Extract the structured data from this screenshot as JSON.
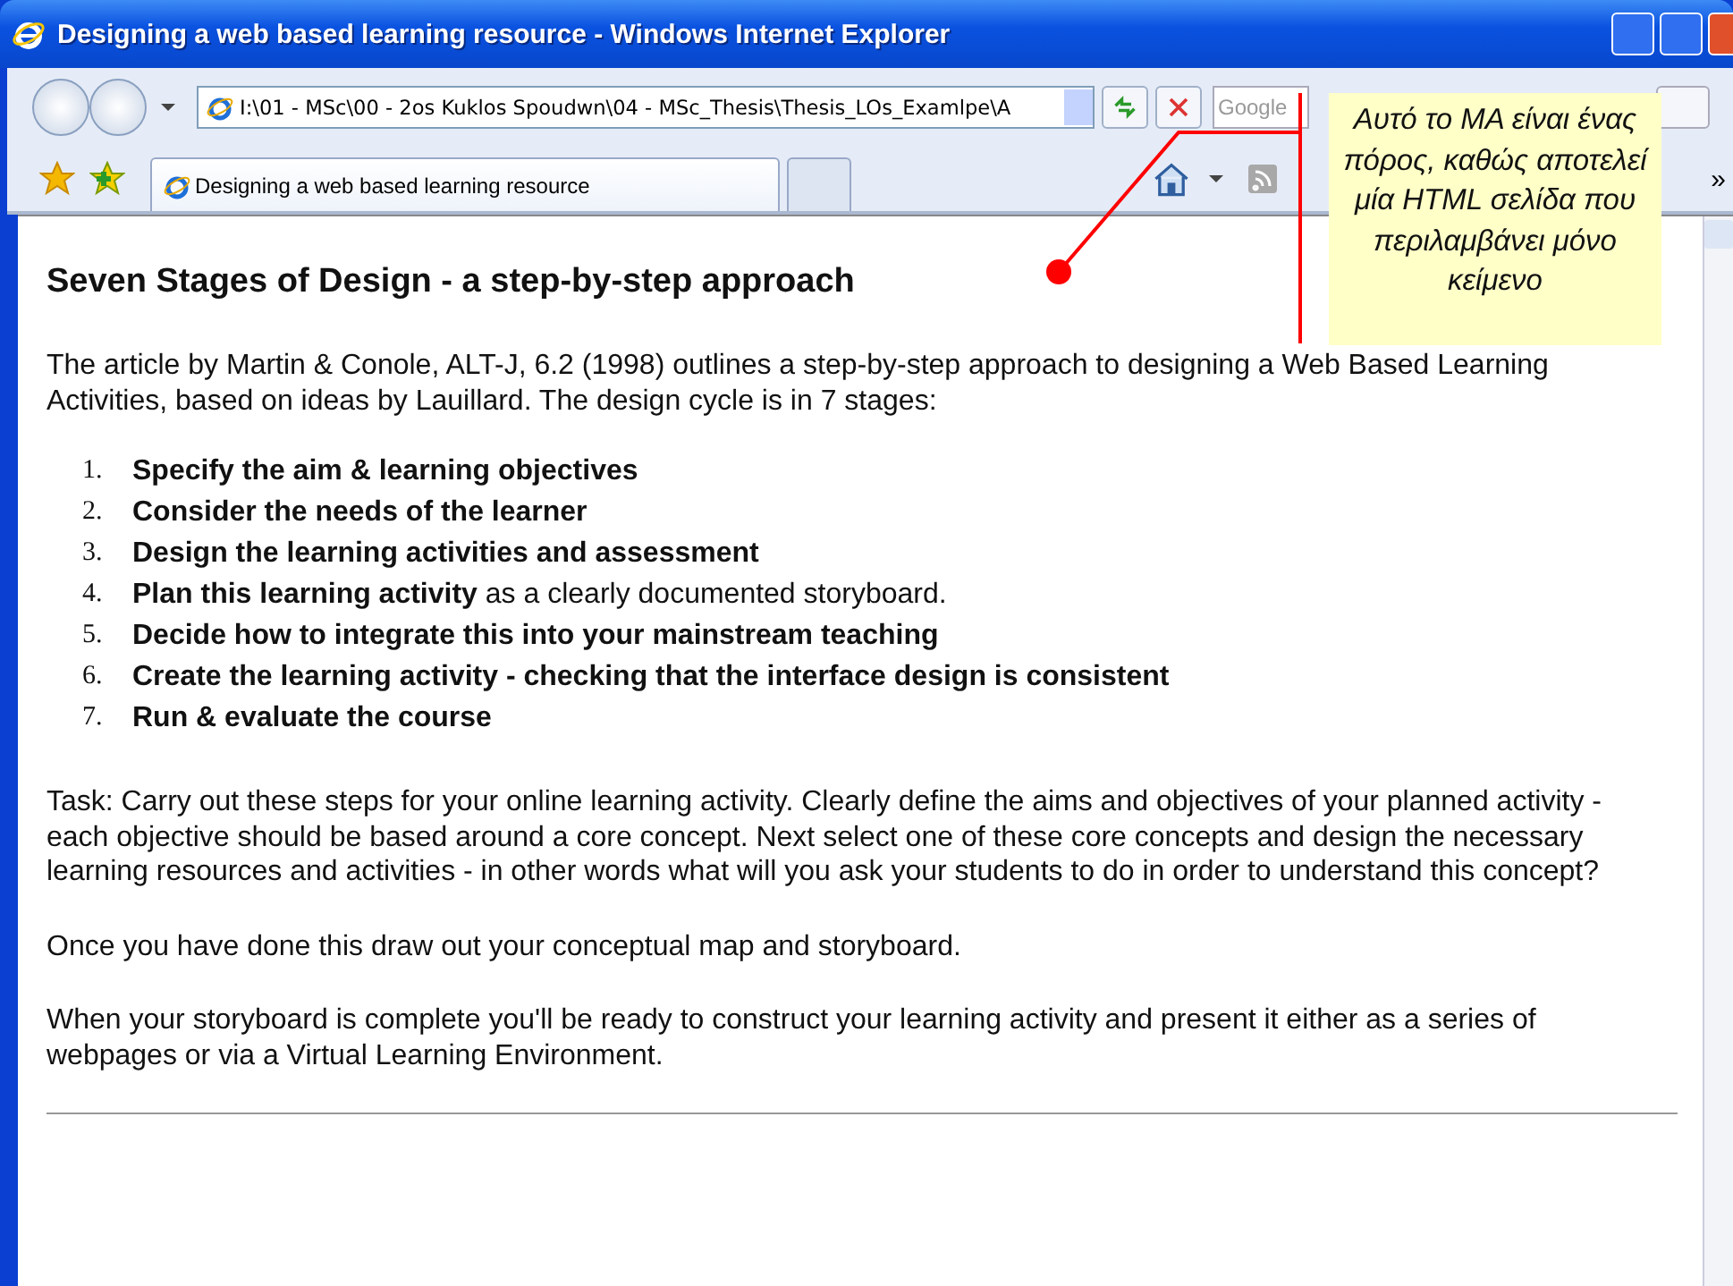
{
  "window": {
    "title": "Designing a web based learning resource - Windows Internet Explorer"
  },
  "address_bar": {
    "value": "I:\\01 - MSc\\00 - 2os Kuklos Spoudwn\\04 - MSc_Thesis\\Thesis_LOs_Examlpe\\A"
  },
  "search": {
    "placeholder": "Google"
  },
  "tabs": [
    {
      "label": "Designing a web based learning resource",
      "selected": true
    },
    {
      "selected": false
    }
  ],
  "toolbar": {
    "overflow": "»"
  },
  "page": {
    "heading": "Seven Stages of Design - a step-by-step approach",
    "intro": "The article by Martin & Conole, ALT-J, 6.2 (1998)  outlines a step-by-step approach to designing a Web Based Learning Activities, based on ideas by Lauillard. The  design cycle is in 7 stages:",
    "steps": [
      {
        "number": "1.",
        "text": "Specify the aim & learning objectives",
        "bold": true
      },
      {
        "number": "2.",
        "text": "Consider the needs of the learner",
        "bold": true
      },
      {
        "number": "3.",
        "text": "Design the learning activities and assessment",
        "bold": true
      },
      {
        "number": "4.",
        "text": "**Plan this learning activity** as a clearly documented storyboard.",
        "bold": false
      },
      {
        "number": "5.",
        "text": "Decide how to integrate this into your mainstream teaching",
        "bold": true
      },
      {
        "number": "6.",
        "text": "Create the learning activity - checking  that the interface design is consistent",
        "bold": true
      },
      {
        "number": "7.",
        "text": "Run & evaluate the course",
        "bold": true
      }
    ],
    "paragraphs": [
      "Task: Carry out these steps for your online learning activity.  Clearly define the aims and objectives of your planned activity - each objective should be based around a core concept. Next select one of these core concepts and design the necessary learning resources and  activities - in other words what will you ask your students to do in order to understand  this concept?",
      "Once you have done this  draw out your conceptual map and storyboard.",
      "When your storyboard is complete you'll be ready to construct your learning activity and present it either as a series of webpages or via a Virtual Learning Environment."
    ]
  },
  "callout": {
    "text": "Αυτό το ΜΑ είναι ένας πόρος, καθώς αποτελεί μία HTML σελίδα που περιλαμβάνει μόνο κείμενο"
  }
}
